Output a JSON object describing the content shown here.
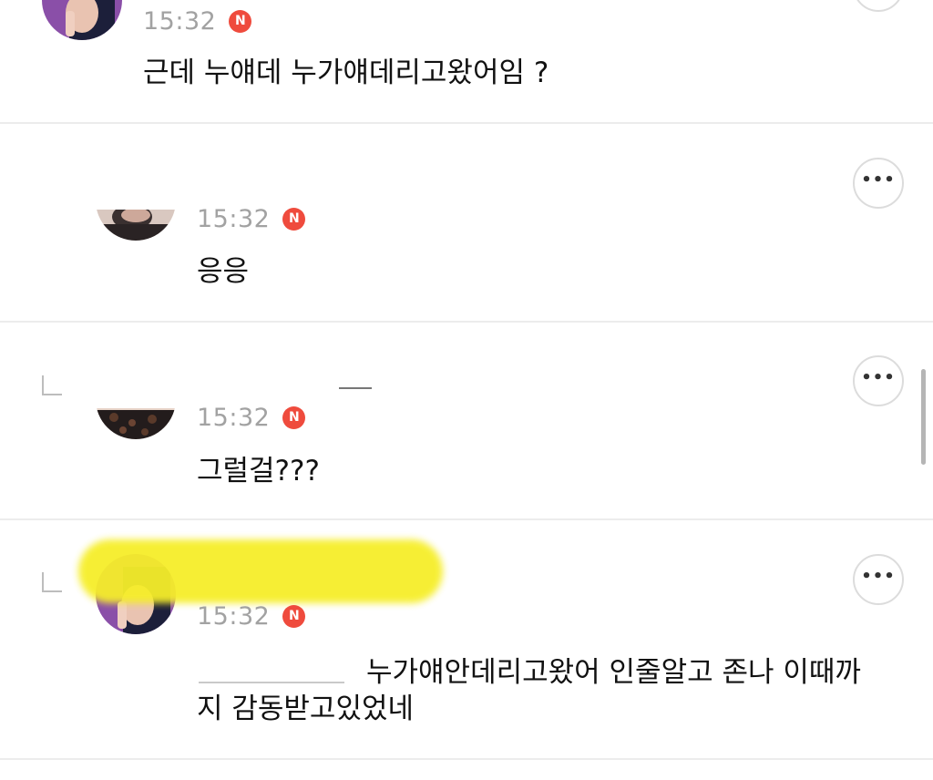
{
  "comments": [
    {
      "time": "15:32",
      "badge": "N",
      "text": "근데 누얘데 누가얘데리고왔어임 ?"
    },
    {
      "time": "15:32",
      "badge": "N",
      "text": "응응",
      "more_label": "•••"
    },
    {
      "time": "15:32",
      "badge": "N",
      "text": "그럴걸???",
      "more_label": "•••"
    },
    {
      "time": "15:32",
      "badge": "N",
      "text_line1": "누가얘안데리고왔어 인줄알고 존나 이때까",
      "text_line2": "지 감동받고있었네",
      "more_label": "•••"
    }
  ],
  "colors": {
    "badge": "#ef4b3d",
    "time": "#a2a2a2",
    "divider": "#ececec",
    "highlight": "#f6ee2a"
  },
  "icons": [
    "more-options-icon",
    "reply-arrow-icon",
    "new-badge-icon"
  ]
}
